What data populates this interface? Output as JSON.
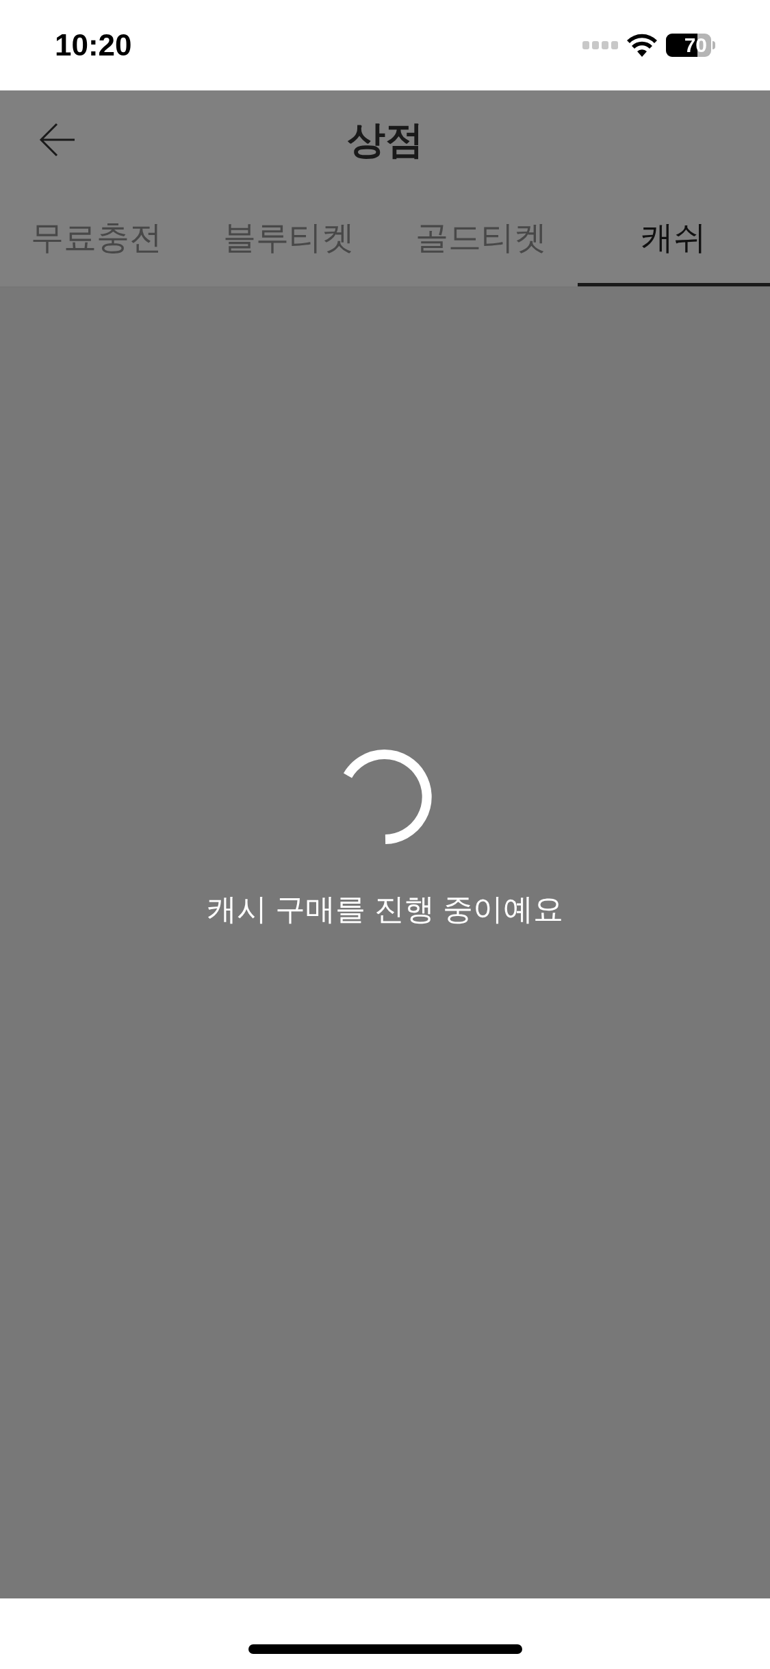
{
  "status_bar": {
    "time": "10:20",
    "battery": "70"
  },
  "header": {
    "title": "상점"
  },
  "tabs": [
    {
      "label": "무료충전",
      "selected": false
    },
    {
      "label": "블루티켓",
      "selected": false
    },
    {
      "label": "골드티켓",
      "selected": false
    },
    {
      "label": "캐쉬",
      "selected": true
    }
  ],
  "loading": {
    "message": "캐시 구매를 진행 중이예요"
  }
}
